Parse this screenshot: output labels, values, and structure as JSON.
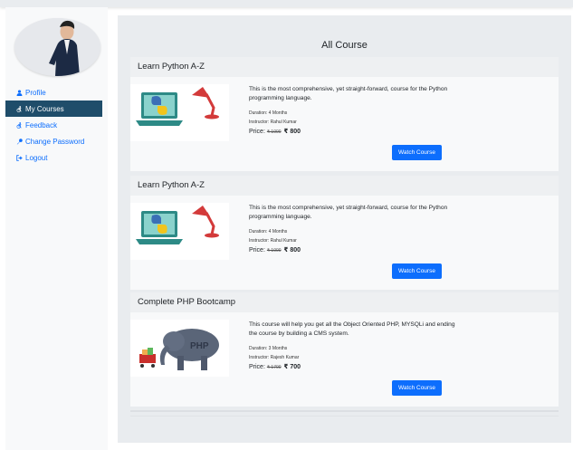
{
  "sidebar": {
    "items": [
      {
        "label": "Profile",
        "icon": "user-icon",
        "active": false
      },
      {
        "label": "My Courses",
        "icon": "accessibility-icon",
        "active": true
      },
      {
        "label": "Feedback",
        "icon": "accessibility-icon",
        "active": false
      },
      {
        "label": "Change Password",
        "icon": "key-icon",
        "active": false
      },
      {
        "label": "Logout",
        "icon": "sign-out-icon",
        "active": false
      }
    ]
  },
  "main": {
    "title": "All Course",
    "courses": [
      {
        "title": "Learn Python A-Z",
        "description": "This is the most comprehensive, yet straight-forward, course for the Python programming language.",
        "duration": "Duration: 4 Months",
        "instructor": "Instructor: Rahul Kumar",
        "price_label": "Price:",
        "old_price": "₹ 1000",
        "new_price": "₹ 800",
        "button": "Watch Course",
        "image": "python-laptop-lamp"
      },
      {
        "title": "Learn Python A-Z",
        "description": "This is the most comprehensive, yet straight-forward, course for the Python programming language.",
        "duration": "Duration: 4 Months",
        "instructor": "Instructor: Rahul Kumar",
        "price_label": "Price:",
        "old_price": "₹ 1000",
        "new_price": "₹ 800",
        "button": "Watch Course",
        "image": "python-laptop-lamp"
      },
      {
        "title": "Complete PHP Bootcamp",
        "description": "This course will help you get all the Object Oriented PHP, MYSQLi and ending the course by building a CMS system.",
        "duration": "Duration: 3 Months",
        "instructor": "Instructor: Rajesh Kumar",
        "price_label": "Price:",
        "old_price": "₹ 1700",
        "new_price": "₹ 700",
        "button": "Watch Course",
        "image": "php-elephant"
      }
    ]
  },
  "colors": {
    "accent": "#0d6efd",
    "active_nav": "#1f4d6a",
    "panel": "#e9ecef"
  }
}
